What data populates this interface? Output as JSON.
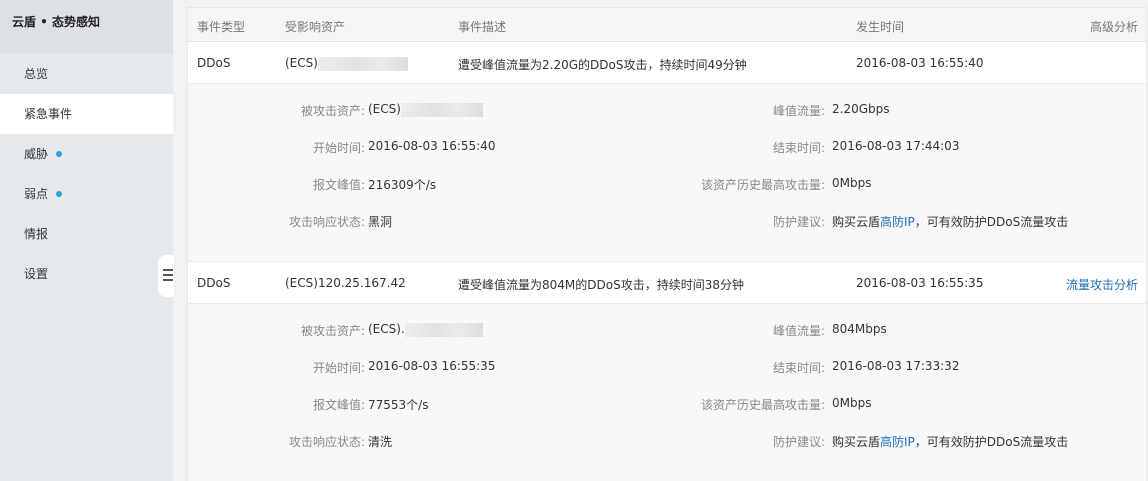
{
  "sidebar": {
    "brand": "云盾 • 态势感知",
    "items": [
      {
        "label": "总览"
      },
      {
        "label": "紧急事件"
      },
      {
        "label": "威胁"
      },
      {
        "label": "弱点"
      },
      {
        "label": "情报"
      },
      {
        "label": "设置"
      }
    ]
  },
  "table": {
    "headers": {
      "type": "事件类型",
      "asset": "受影响资产",
      "desc": "事件描述",
      "time": "发生时间",
      "action": "高级分析"
    }
  },
  "events": [
    {
      "type": "DDoS",
      "asset_prefix": "(ECS)",
      "asset_ip": "",
      "description": "遭受峰值流量为2.20G的DDoS攻击，持续时间49分钟",
      "time": "2016-08-03 16:55:40",
      "action": "",
      "details": {
        "attacked_asset_label": "被攻击资产:",
        "attacked_asset_value": "(ECS)",
        "peak_traffic_label": "峰值流量:",
        "peak_traffic_value": "2.20Gbps",
        "start_label": "开始时间:",
        "start_value": "2016-08-03 16:55:40",
        "end_label": "结束时间:",
        "end_value": "2016-08-03 17:44:03",
        "packet_peak_label": "报文峰值:",
        "packet_peak_value": "216309个/s",
        "history_max_label": "该资产历史最高攻击量:",
        "history_max_value": "0Mbps",
        "response_label": "攻击响应状态:",
        "response_value": "黑洞",
        "advice_label": "防护建议:",
        "advice_prefix": "购买云盾",
        "advice_link": "高防IP",
        "advice_suffix": "，可有效防护DDoS流量攻击"
      }
    },
    {
      "type": "DDoS",
      "asset_prefix": "(ECS)",
      "asset_ip": "120.25.167.42",
      "description": "遭受峰值流量为804M的DDoS攻击，持续时间38分钟",
      "time": "2016-08-03 16:55:35",
      "action": "流量攻击分析",
      "details": {
        "attacked_asset_label": "被攻击资产:",
        "attacked_asset_value": "(ECS).",
        "peak_traffic_label": "峰值流量:",
        "peak_traffic_value": "804Mbps",
        "start_label": "开始时间:",
        "start_value": "2016-08-03 16:55:35",
        "end_label": "结束时间:",
        "end_value": "2016-08-03 17:33:32",
        "packet_peak_label": "报文峰值:",
        "packet_peak_value": "77553个/s",
        "history_max_label": "该资产历史最高攻击量:",
        "history_max_value": "0Mbps",
        "response_label": "攻击响应状态:",
        "response_value": "清洗",
        "advice_label": "防护建议:",
        "advice_prefix": "购买云盾",
        "advice_link": "高防IP",
        "advice_suffix": "，可有效防护DDoS流量攻击"
      }
    }
  ],
  "colors": {
    "sidebar_bg": "#e6e9ec",
    "active_bg": "#ffffff",
    "dot": "#2aa3d4",
    "link": "#1e6bb8",
    "detail_bg": "#f7f8f9"
  }
}
